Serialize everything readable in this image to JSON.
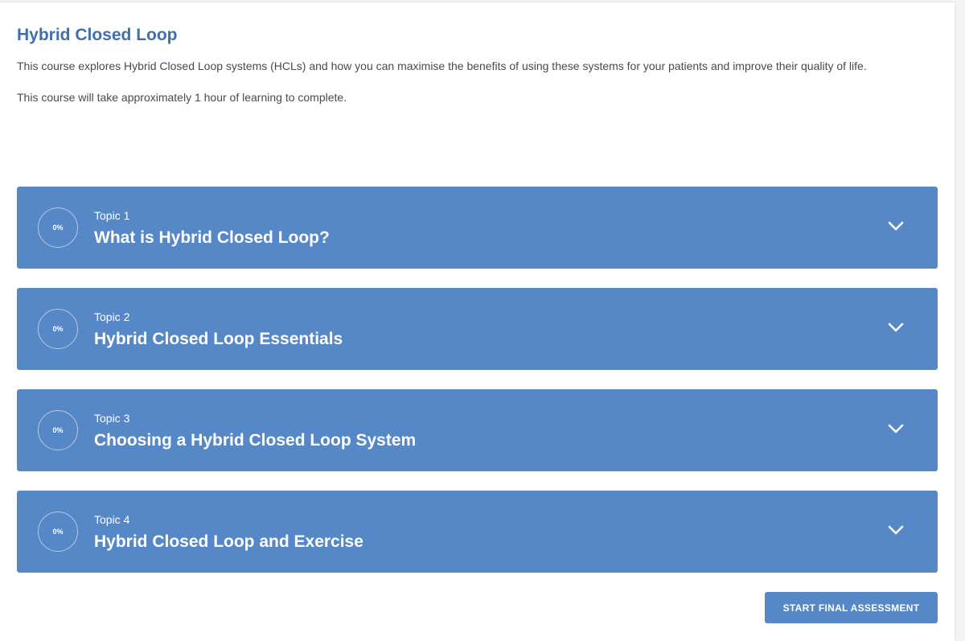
{
  "course": {
    "title": "Hybrid Closed Loop",
    "description": "This course explores Hybrid Closed Loop systems (HCLs) and how you can maximise the benefits of using these systems for your patients and improve their quality of life.",
    "duration_text": "This course will take approximately 1 hour of learning to complete."
  },
  "topics": [
    {
      "eyebrow": "Topic 1",
      "title": "What is Hybrid Closed Loop?",
      "progress_label": "0%",
      "progress": 0,
      "icon": "chevron-down-icon"
    },
    {
      "eyebrow": "Topic 2",
      "title": "Hybrid Closed Loop Essentials",
      "progress_label": "0%",
      "progress": 0,
      "icon": "chevron-down-icon"
    },
    {
      "eyebrow": "Topic 3",
      "title": "Choosing a Hybrid Closed Loop System",
      "progress_label": "0%",
      "progress": 0,
      "icon": "chevron-down-icon"
    },
    {
      "eyebrow": "Topic 4",
      "title": "Hybrid Closed Loop and Exercise",
      "progress_label": "0%",
      "progress": 0,
      "icon": "chevron-down-icon"
    }
  ],
  "actions": {
    "final_assessment_label": "START FINAL ASSESSMENT"
  },
  "colors": {
    "accent": "#5687c6",
    "title": "#3f6fae",
    "body_text": "#4a4a4a"
  }
}
